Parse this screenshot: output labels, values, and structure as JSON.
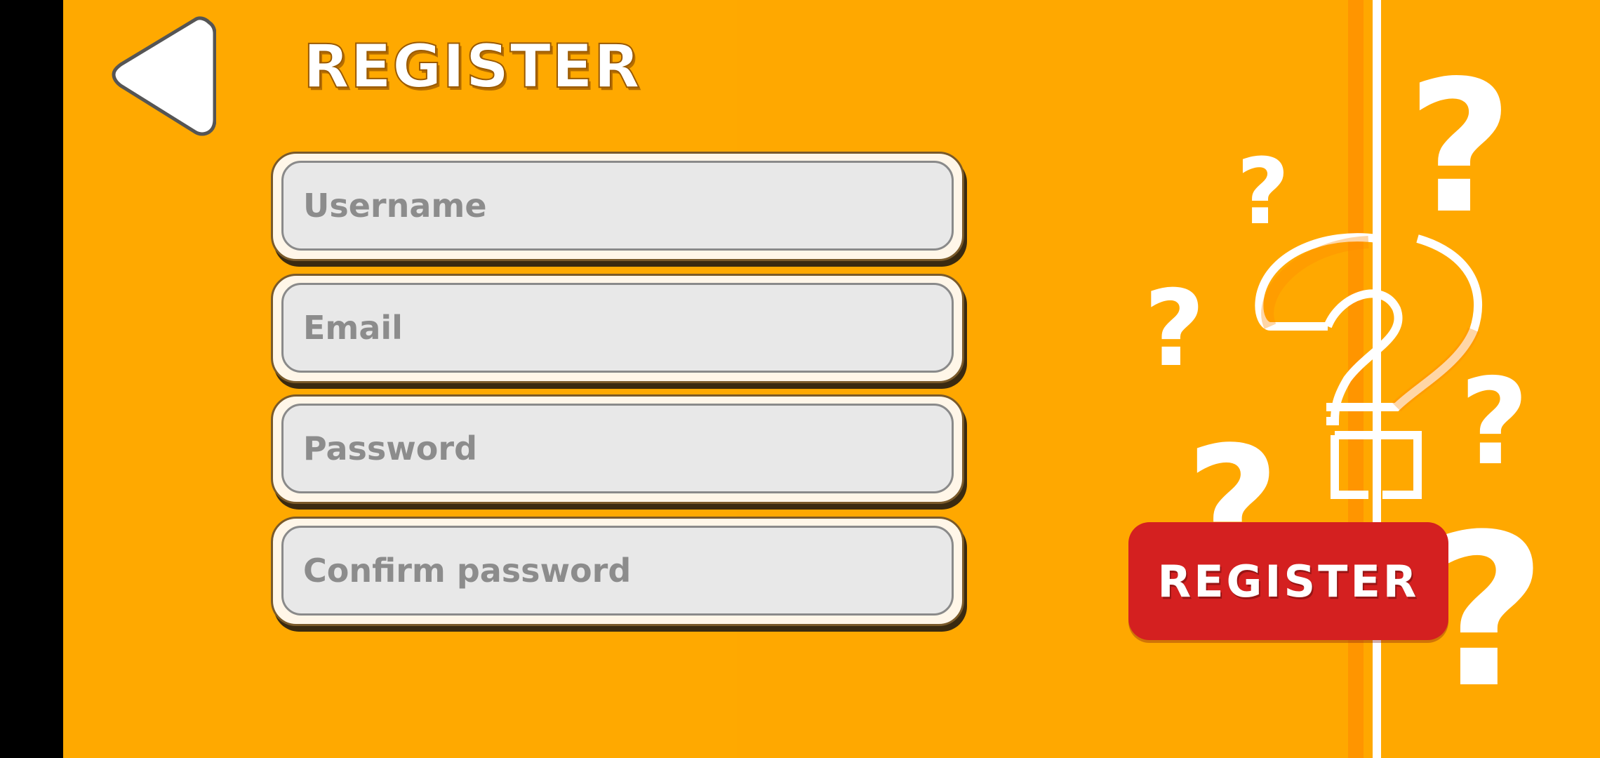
{
  "screen": {
    "title": "REGISTER",
    "background_color": "#FFA800",
    "accent_red": "#D42020"
  },
  "back": {
    "icon": "back-triangle-icon"
  },
  "form": {
    "username": {
      "placeholder": "Username",
      "value": ""
    },
    "email": {
      "placeholder": "Email",
      "value": ""
    },
    "password": {
      "placeholder": "Password",
      "value": ""
    },
    "confirm_password": {
      "placeholder": "Confirm password",
      "value": ""
    }
  },
  "actions": {
    "register_label": "REGISTER"
  },
  "decoration": {
    "icon": "question-marks-icon"
  }
}
